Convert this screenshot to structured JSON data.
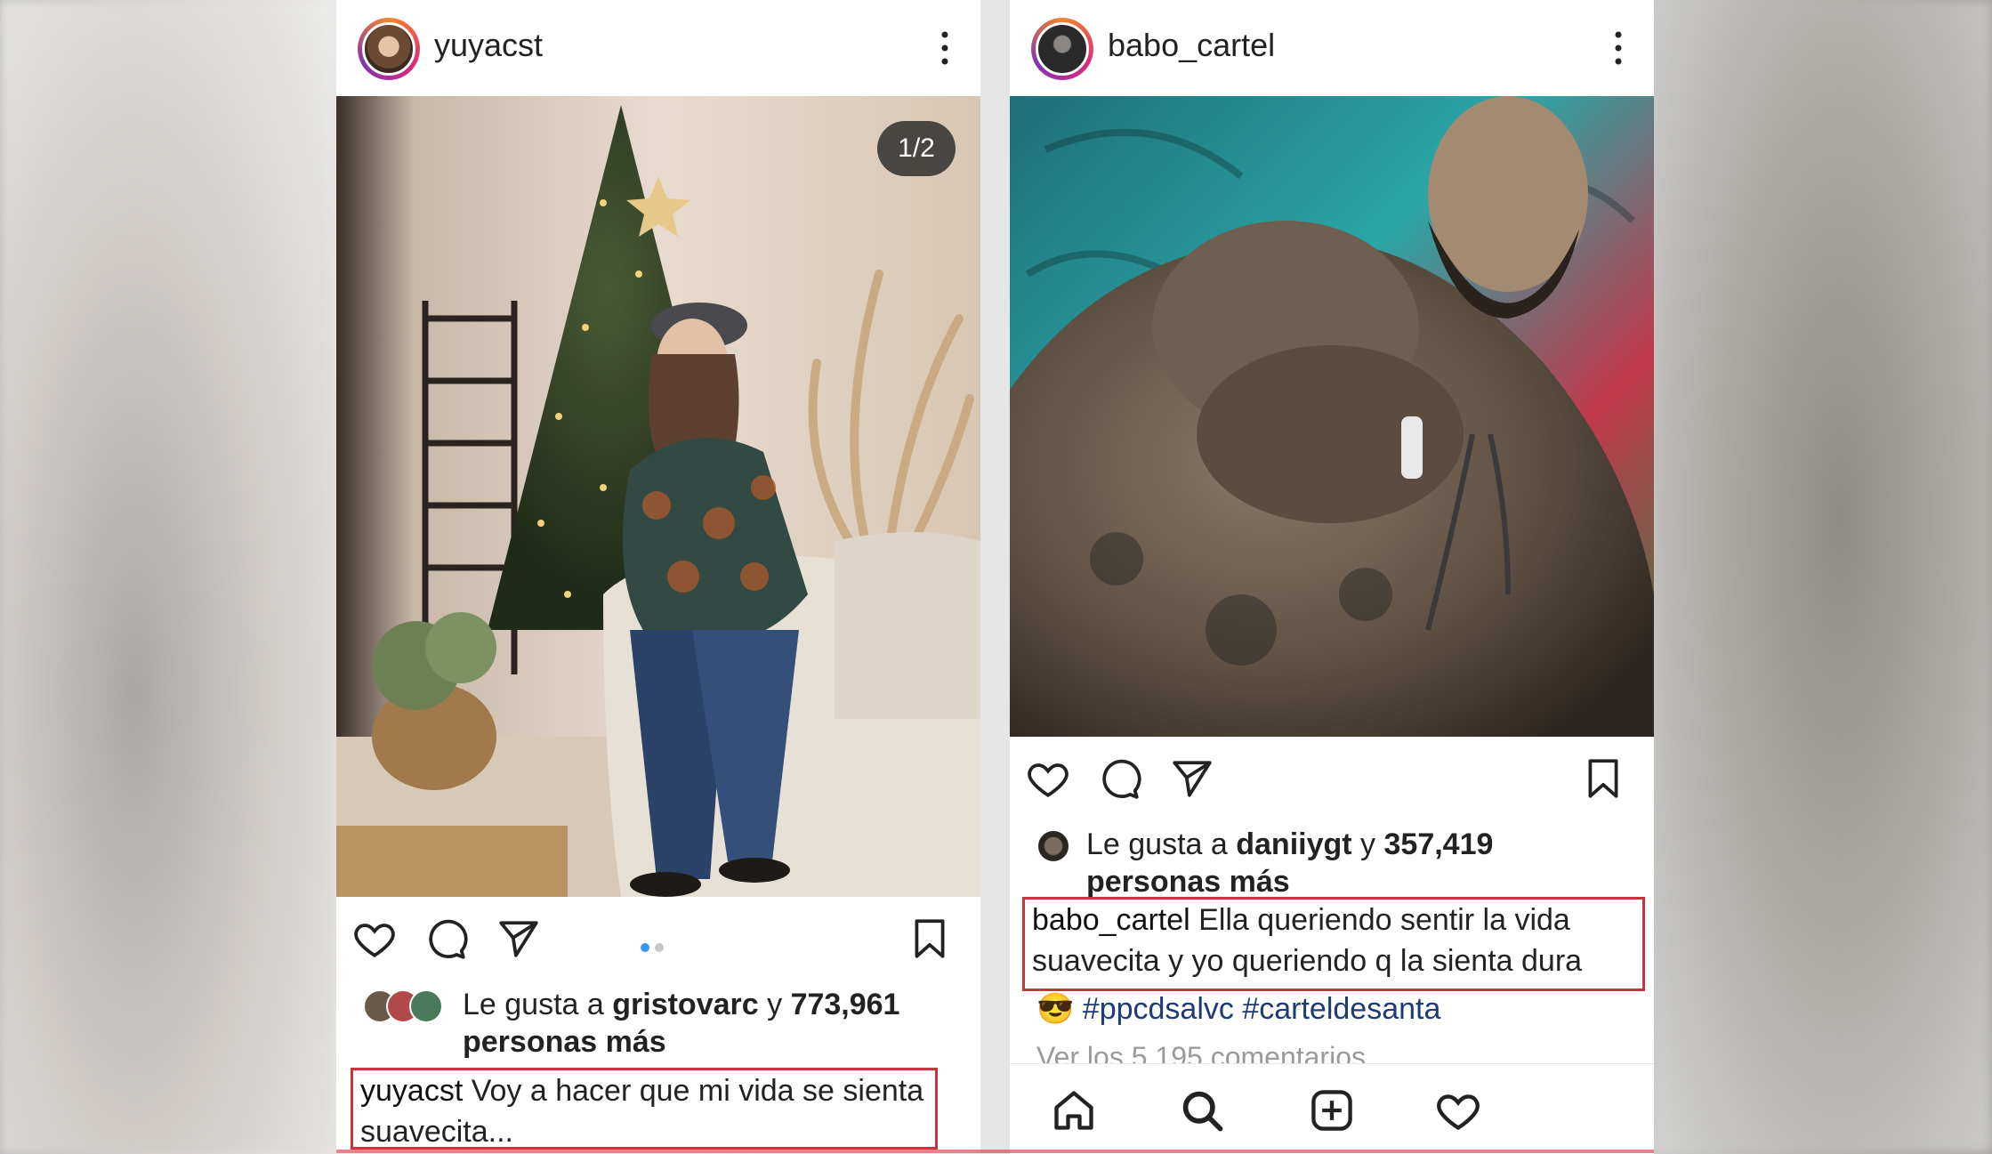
{
  "left_post": {
    "username": "yuyacst",
    "photo_counter": "1/2",
    "likes": {
      "prefix": "Le gusta a",
      "user": "gristovarc",
      "connector": "y",
      "count": "773,961",
      "suffix": "personas más"
    },
    "caption": {
      "user": "yuyacst",
      "text": "Voy a hacer que mi vida se sienta suavecita..."
    },
    "carousel": {
      "total": 2,
      "active": 1
    }
  },
  "right_post": {
    "username": "babo_cartel",
    "likes": {
      "prefix": "Le gusta a",
      "user": "daniiygt",
      "connector": "y",
      "count": "357,419",
      "suffix": "personas más"
    },
    "caption": {
      "user": "babo_cartel",
      "text": "Ella queriendo sentir la vida suavecita y yo queriendo q la sienta dura"
    },
    "hashtags": "#ppcdsalvc #carteldesanta",
    "hashtag_emoji": "😎",
    "comments_link": "Ver los 5,195 comentarios"
  },
  "icons": [
    "more-icon",
    "heart-icon",
    "comment-icon",
    "share-icon",
    "bookmark-icon",
    "home-icon",
    "search-icon",
    "add-icon"
  ],
  "colors": {
    "highlight_box": "#c8343c",
    "hashtag": "#1f3b73",
    "carousel_active": "#3897f0",
    "carousel_inactive": "#c7c7c7"
  }
}
